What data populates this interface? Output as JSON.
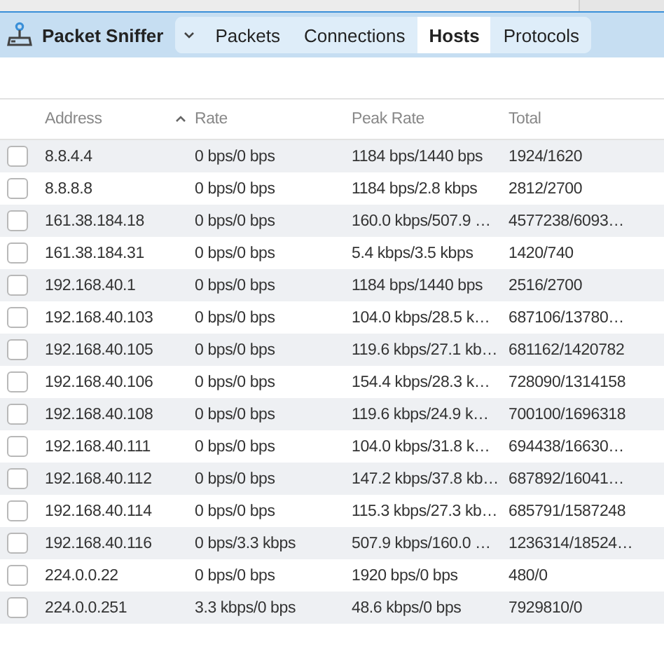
{
  "app": {
    "title": "Packet Sniffer"
  },
  "tabs": [
    {
      "label": "Packets",
      "selected": false
    },
    {
      "label": "Connections",
      "selected": false
    },
    {
      "label": "Hosts",
      "selected": true
    },
    {
      "label": "Protocols",
      "selected": false
    }
  ],
  "table": {
    "columns": [
      {
        "label": "Address",
        "sorted": false
      },
      {
        "label": "Rate",
        "sorted": true
      },
      {
        "label": "Peak Rate",
        "sorted": false
      },
      {
        "label": "Total",
        "sorted": false
      }
    ],
    "rows": [
      {
        "checked": false,
        "cells": [
          "8.8.4.4",
          "0 bps/0 bps",
          "1184 bps/1440 bps",
          "1924/1620"
        ]
      },
      {
        "checked": false,
        "cells": [
          "8.8.8.8",
          "0 bps/0 bps",
          "1184 bps/2.8 kbps",
          "2812/2700"
        ]
      },
      {
        "checked": false,
        "cells": [
          "161.38.184.18",
          "0 bps/0 bps",
          "160.0 kbps/507.9 …",
          "4577238/6093…"
        ]
      },
      {
        "checked": false,
        "cells": [
          "161.38.184.31",
          "0 bps/0 bps",
          "5.4 kbps/3.5 kbps",
          "1420/740"
        ]
      },
      {
        "checked": false,
        "cells": [
          "192.168.40.1",
          "0 bps/0 bps",
          "1184 bps/1440 bps",
          "2516/2700"
        ]
      },
      {
        "checked": false,
        "cells": [
          "192.168.40.103",
          "0 bps/0 bps",
          "104.0 kbps/28.5 k…",
          "687106/13780…"
        ]
      },
      {
        "checked": false,
        "cells": [
          "192.168.40.105",
          "0 bps/0 bps",
          "119.6 kbps/27.1 kb…",
          "681162/1420782"
        ]
      },
      {
        "checked": false,
        "cells": [
          "192.168.40.106",
          "0 bps/0 bps",
          "154.4 kbps/28.3 k…",
          "728090/1314158"
        ]
      },
      {
        "checked": false,
        "cells": [
          "192.168.40.108",
          "0 bps/0 bps",
          "119.6 kbps/24.9 k…",
          "700100/1696318"
        ]
      },
      {
        "checked": false,
        "cells": [
          "192.168.40.111",
          "0 bps/0 bps",
          "104.0 kbps/31.8 k…",
          "694438/16630…"
        ]
      },
      {
        "checked": false,
        "cells": [
          "192.168.40.112",
          "0 bps/0 bps",
          "147.2 kbps/37.8 kb…",
          "687892/16041…"
        ]
      },
      {
        "checked": false,
        "cells": [
          "192.168.40.114",
          "0 bps/0 bps",
          "115.3 kbps/27.3 kb…",
          "685791/1587248"
        ]
      },
      {
        "checked": false,
        "cells": [
          "192.168.40.116",
          "0 bps/3.3 kbps",
          "507.9 kbps/160.0 …",
          "1236314/18524…"
        ]
      },
      {
        "checked": false,
        "cells": [
          "224.0.0.22",
          "0 bps/0 bps",
          "1920 bps/0 bps",
          "480/0"
        ]
      },
      {
        "checked": false,
        "cells": [
          "224.0.0.251",
          "3.3 kbps/0 bps",
          "48.6 kbps/0 bps",
          "7929810/0"
        ]
      }
    ]
  }
}
